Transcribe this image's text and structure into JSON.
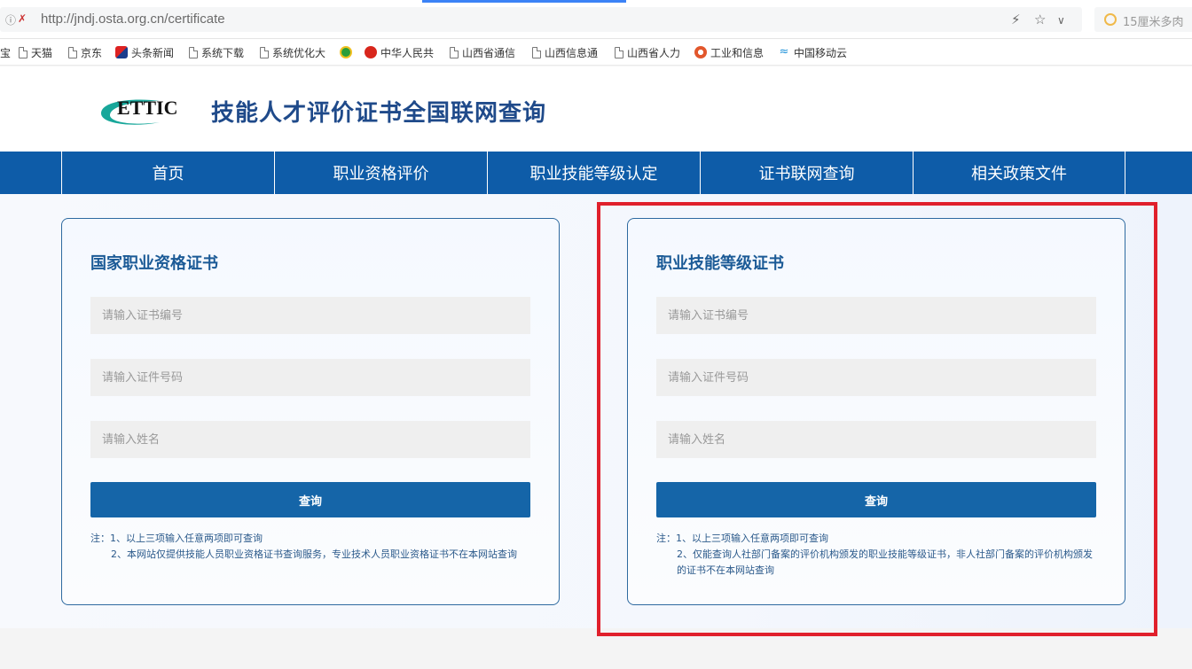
{
  "browser": {
    "url": "http://jndj.osta.org.cn/certificate",
    "search_text": "15厘米多肉",
    "bookmarks": [
      {
        "label": "宝"
      },
      {
        "label": "天猫"
      },
      {
        "label": "京东"
      },
      {
        "label": "头条新闻"
      },
      {
        "label": "系统下载"
      },
      {
        "label": "系统优化大"
      },
      {
        "label": ""
      },
      {
        "label": "中华人民共"
      },
      {
        "label": "山西省通信"
      },
      {
        "label": "山西信息通"
      },
      {
        "label": "山西省人力"
      },
      {
        "label": "工业和信息"
      },
      {
        "label": "中国移动云"
      }
    ]
  },
  "site": {
    "logo_text": "ETTIC",
    "title": "技能人才评价证书全国联网查询"
  },
  "nav": [
    "首页",
    "职业资格评价",
    "职业技能等级认定",
    "证书联网查询",
    "相关政策文件"
  ],
  "cards": [
    {
      "title": "国家职业资格证书",
      "fields": {
        "cert_no": "请输入证书编号",
        "id_no": "请输入证件号码",
        "name": "请输入姓名"
      },
      "button": "查询",
      "note1": "注：1、以上三项输入任意两项即可查询",
      "note2": "2、本网站仅提供技能人员职业资格证书查询服务，专业技术人员职业资格证书不在本网站查询"
    },
    {
      "title": "职业技能等级证书",
      "fields": {
        "cert_no": "请输入证书编号",
        "id_no": "请输入证件号码",
        "name": "请输入姓名"
      },
      "button": "查询",
      "note1": "注：1、以上三项输入任意两项即可查询",
      "note2": "2、仅能查询人社部门备案的评价机构颁发的职业技能等级证书，非人社部门备案的评价机构颁发的证书不在本网站查询"
    }
  ],
  "colors": {
    "nav": "#0e5ca8",
    "accent": "#1565a8",
    "highlight": "#e0202c",
    "title": "#1f4a8a"
  }
}
